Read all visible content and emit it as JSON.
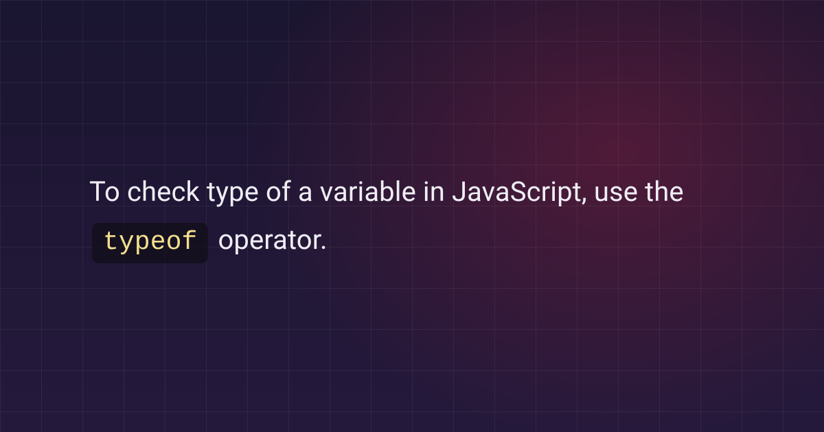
{
  "tip": {
    "text_before": "To check type of a variable in JavaScript, use the ",
    "code": "typeof",
    "text_after": " operator."
  },
  "colors": {
    "background_dark": "#1a1530",
    "background_light": "#25193b",
    "accent_glow": "#781e3c",
    "text": "#f0eef5",
    "code_text": "#f3df8e",
    "code_bg": "rgba(15,12,22,0.65)"
  }
}
